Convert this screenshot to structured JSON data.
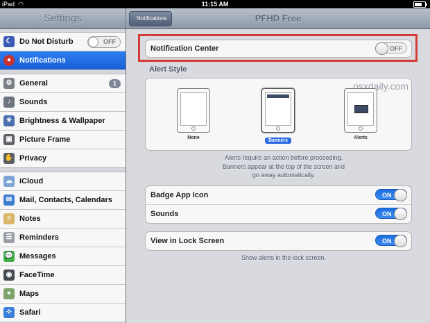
{
  "status": {
    "carrier": "iPad",
    "time": "11:15 AM"
  },
  "sidebar": {
    "title": "Settings",
    "groups": [
      [
        {
          "label": "Do Not Disturb",
          "icon": "moon-icon",
          "toggle": "OFF"
        },
        {
          "label": "Notifications",
          "icon": "notifications-icon",
          "selected": true
        }
      ],
      [
        {
          "label": "General",
          "icon": "gear-icon",
          "badge": "1"
        },
        {
          "label": "Sounds",
          "icon": "speaker-icon"
        },
        {
          "label": "Brightness & Wallpaper",
          "icon": "brightness-icon"
        },
        {
          "label": "Picture Frame",
          "icon": "picture-frame-icon"
        },
        {
          "label": "Privacy",
          "icon": "hand-icon"
        }
      ],
      [
        {
          "label": "iCloud",
          "icon": "cloud-icon"
        },
        {
          "label": "Mail, Contacts, Calendars",
          "icon": "mail-icon"
        },
        {
          "label": "Notes",
          "icon": "notes-icon"
        },
        {
          "label": "Reminders",
          "icon": "reminders-icon"
        },
        {
          "label": "Messages",
          "icon": "messages-icon"
        },
        {
          "label": "FaceTime",
          "icon": "facetime-icon"
        },
        {
          "label": "Maps",
          "icon": "maps-icon"
        },
        {
          "label": "Safari",
          "icon": "safari-icon"
        }
      ]
    ]
  },
  "detail": {
    "back_label": "Notifications",
    "title": "PFHD Free",
    "notification_center": {
      "label": "Notification Center",
      "state": "OFF"
    },
    "alert_style_label": "Alert Style",
    "alert_options": [
      "None",
      "Banners",
      "Alerts"
    ],
    "alert_selected": "Banners",
    "watermark": "osxdaily.com",
    "alert_note_1": "Alerts require an action before proceeding.",
    "alert_note_2": "Banners appear at the top of the screen and",
    "alert_note_3": "go away automatically.",
    "badge_app_icon": {
      "label": "Badge App Icon",
      "state": "ON"
    },
    "sounds": {
      "label": "Sounds",
      "state": "ON"
    },
    "lock_screen": {
      "label": "View in Lock Screen",
      "state": "ON"
    },
    "lock_note": "Show alerts in the lock screen."
  },
  "colors": {
    "selected_row": "#1a5ed6",
    "toggle_on": "#1d6fdf",
    "highlight_frame": "#d43b34"
  }
}
